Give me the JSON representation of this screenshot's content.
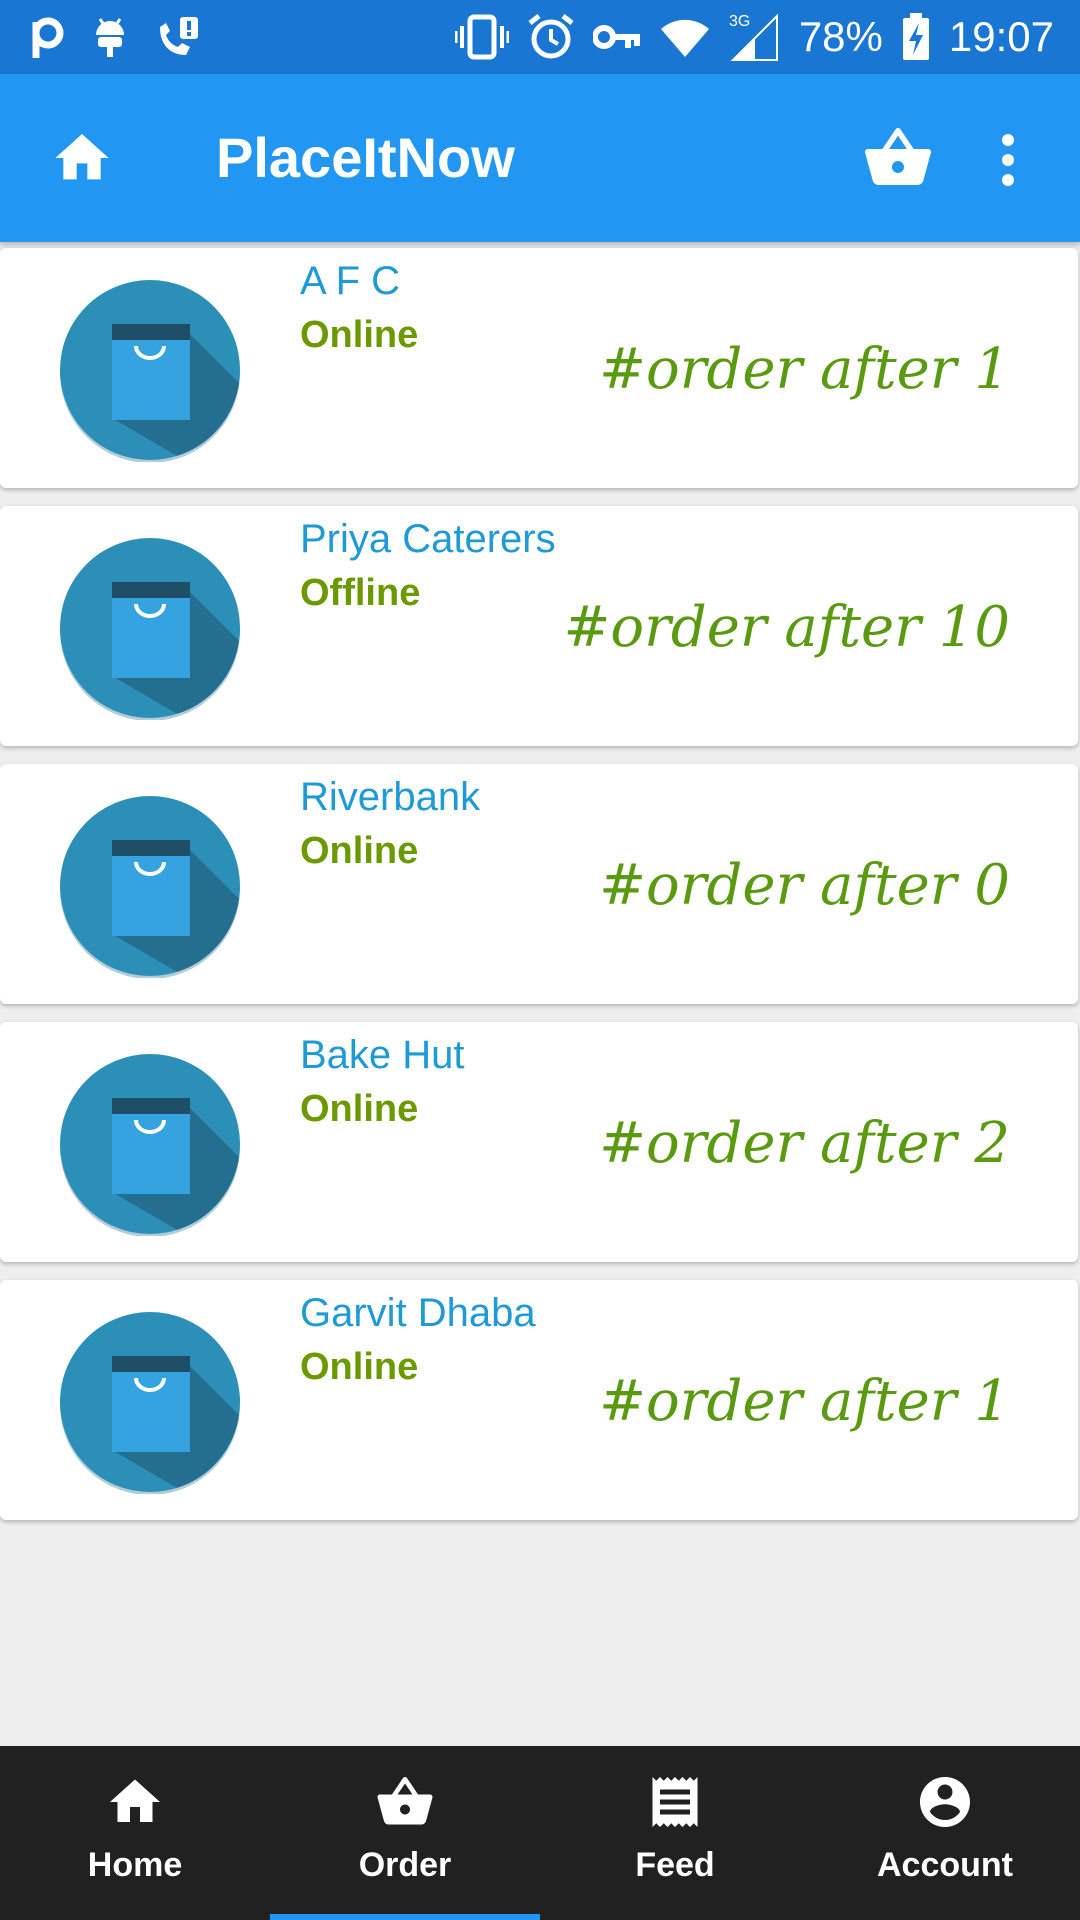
{
  "status_bar": {
    "battery": "78%",
    "time": "19:07",
    "network": "3G"
  },
  "app_bar": {
    "title": "PlaceItNow"
  },
  "shops": [
    {
      "name": "A F C",
      "status": "Online",
      "order_after": "#order after 1"
    },
    {
      "name": "Priya Caterers",
      "status": "Offline",
      "order_after": "#order after 10"
    },
    {
      "name": "Riverbank",
      "status": "Online",
      "order_after": "#order after 0"
    },
    {
      "name": "Bake Hut",
      "status": "Online",
      "order_after": "#order after 2"
    },
    {
      "name": "Garvit Dhaba",
      "status": "Online",
      "order_after": "#order after 1"
    }
  ],
  "bottom_nav": {
    "items": [
      {
        "label": "Home",
        "icon": "home-icon"
      },
      {
        "label": "Order",
        "icon": "basket-icon"
      },
      {
        "label": "Feed",
        "icon": "receipt-icon"
      },
      {
        "label": "Account",
        "icon": "account-circle-icon"
      }
    ],
    "active": "Order"
  },
  "colors": {
    "status_bar": "#1976d2",
    "app_bar": "#2196f3",
    "shop_name": "#1e9ad6",
    "status_text": "#6a9a00",
    "nav_bg": "#212121",
    "avatar": "#2b8fb8"
  }
}
